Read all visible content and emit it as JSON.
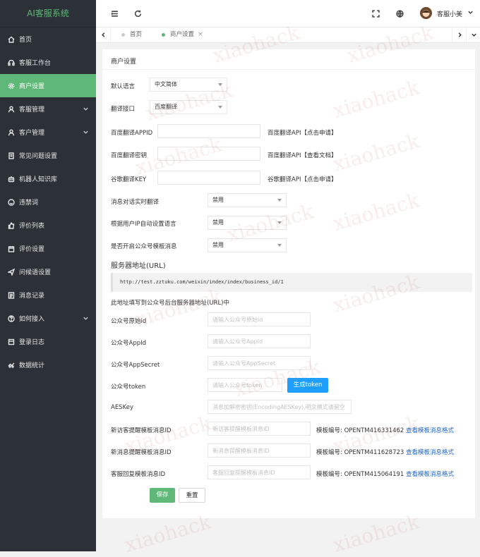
{
  "sidebar": {
    "title": "AI客服系统",
    "items": [
      {
        "label": "首页",
        "icon": "home-icon"
      },
      {
        "label": "客服工作台",
        "icon": "headset-icon"
      },
      {
        "label": "商户设置",
        "icon": "gear-icon",
        "active": true
      },
      {
        "label": "客服管理",
        "icon": "user-icon",
        "expandable": true
      },
      {
        "label": "客户管理",
        "icon": "user-icon",
        "expandable": true
      },
      {
        "label": "常见问题设置",
        "icon": "document-icon"
      },
      {
        "label": "机器人知识库",
        "icon": "robot-icon"
      },
      {
        "label": "违禁词",
        "icon": "face-icon"
      },
      {
        "label": "评价列表",
        "icon": "thumbs-up-icon"
      },
      {
        "label": "评价设置",
        "icon": "calendar-icon"
      },
      {
        "label": "问候语设置",
        "icon": "send-icon"
      },
      {
        "label": "消息记录",
        "icon": "list-icon"
      },
      {
        "label": "如何接入",
        "icon": "help-icon",
        "expandable": true
      },
      {
        "label": "登录日志",
        "icon": "log-icon"
      },
      {
        "label": "数据统计",
        "icon": "chart-icon"
      }
    ]
  },
  "header": {
    "user_name": "客服小美"
  },
  "tabs": [
    {
      "label": "首页"
    },
    {
      "label": "商户设置",
      "active": true,
      "close": "×"
    }
  ],
  "form": {
    "title": "商户设置",
    "default_lang_label": "默认语言",
    "default_lang_value": "中文简体",
    "translate_api_label": "翻译接口",
    "translate_api_value": "百度翻译",
    "baidu_appid_label": "百度翻译APPID",
    "baidu_appid_hint": "百度翻译API【点击申请】",
    "baidu_key_label": "百度翻译密钥",
    "baidu_key_hint": "百度翻译API【查看文档】",
    "google_key_label": "谷歌翻译KEY",
    "google_key_hint": "谷歌翻译API【点击申请】",
    "realtime_label": "消息对话实时翻译",
    "realtime_value": "禁用",
    "ip_lang_label": "根据用户IP自动设置语言",
    "ip_lang_value": "禁用",
    "mp_template_label": "是否开启公众号模板消息",
    "mp_template_value": "禁用",
    "server_url_label": "服务器地址(URL)",
    "server_url_value": "http://test.zztuku.com/weixin/index/index/business_id/1",
    "server_url_hint": "此地址填写到公众号后台服务器地址(URL)中",
    "mp_origin_label": "公众号原始id",
    "mp_origin_placeholder": "请输入公众号原始id",
    "mp_appid_label": "公众号AppId",
    "mp_appid_placeholder": "请输入公众号AppId",
    "mp_secret_label": "公众号AppSecret",
    "mp_secret_placeholder": "请输入公众号AppSecret",
    "mp_token_label": "公众号token",
    "mp_token_placeholder": "请输入公众号token",
    "gen_token_button": "生成token",
    "aeskey_label": "AESKey",
    "aeskey_placeholder": "消息加解密密钥(EncodingAESKey),明文模式请留空",
    "new_visitor_label": "新访客提醒模板消息ID",
    "new_visitor_placeholder": "新访客提醒模板消息ID",
    "new_visitor_template": "模板编号: OPENTM416331462",
    "new_visitor_link": "查看模板消息格式",
    "new_msg_label": "新消息提醒模板消息ID",
    "new_msg_placeholder": "新消息提醒模板消息ID",
    "new_msg_template": "模板编号: OPENTM411628723",
    "new_msg_link": "查看模板消息格式",
    "reply_label": "客服回复模板消息ID",
    "reply_placeholder": "客服回复提醒模板消息ID",
    "reply_template": "模板编号: OPENTM415064191",
    "reply_link": "查看模板消息格式",
    "save_button": "保存",
    "reset_button": "重置"
  },
  "watermark": "xiaohack",
  "colors": {
    "sidebar_bg": "#2b3136",
    "accent": "#5fb878",
    "token_button": "#1e9fff",
    "link": "#1e63c8"
  }
}
